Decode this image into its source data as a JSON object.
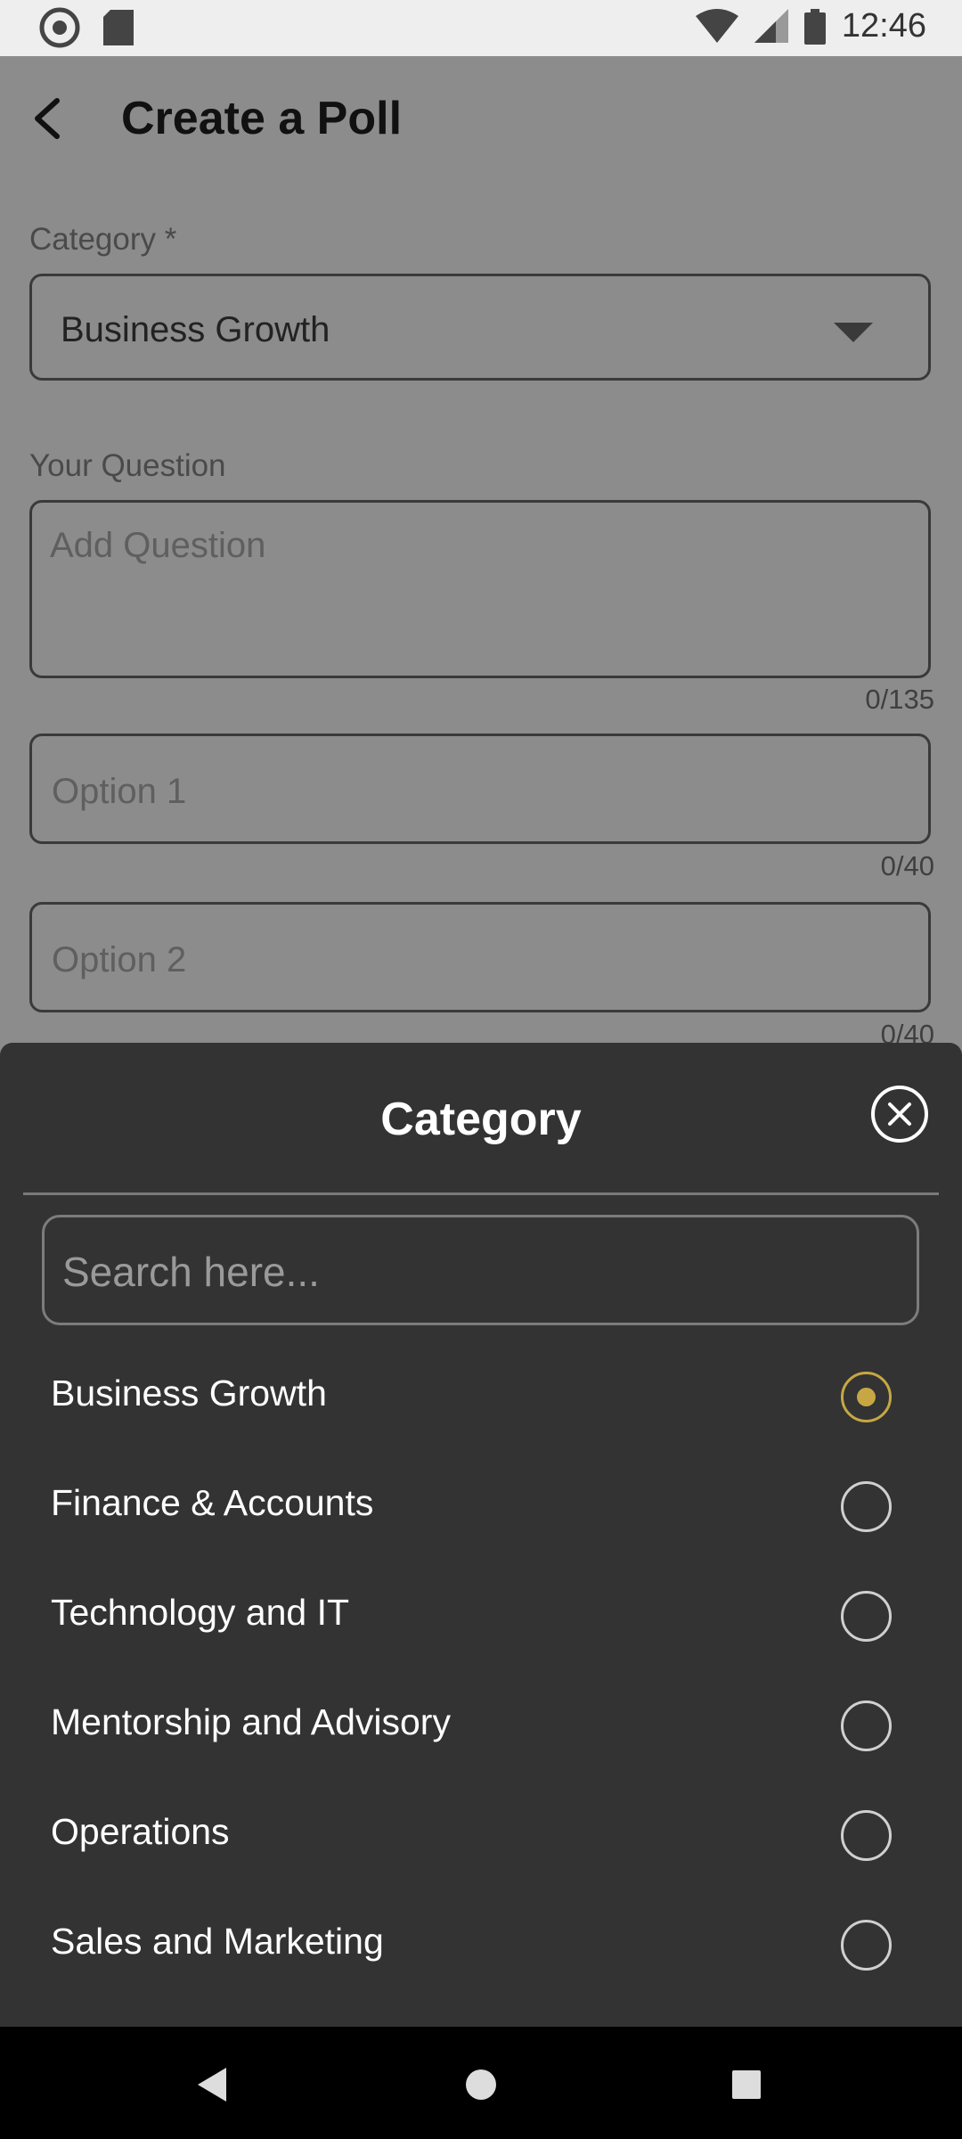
{
  "status_bar": {
    "time": "12:46",
    "icons": [
      "sync-icon",
      "sd-card-icon",
      "wifi-icon",
      "signal-icon",
      "battery-icon"
    ]
  },
  "page": {
    "title": "Create a Poll",
    "category_label": "Category *",
    "category_value": "Business Growth",
    "question_label": "Your Question",
    "question_placeholder": "Add Question",
    "question_counter": "0/135",
    "option1_placeholder": "Option 1",
    "option1_counter": "0/40",
    "option2_placeholder": "Option 2",
    "option2_counter": "0/40"
  },
  "sheet": {
    "title": "Category",
    "search_placeholder": "Search here...",
    "items": [
      {
        "label": "Business Growth",
        "selected": true
      },
      {
        "label": "Finance & Accounts",
        "selected": false
      },
      {
        "label": "Technology and IT",
        "selected": false
      },
      {
        "label": "Mentorship and Advisory",
        "selected": false
      },
      {
        "label": "Operations",
        "selected": false
      },
      {
        "label": "Sales and Marketing",
        "selected": false
      }
    ]
  },
  "colors": {
    "accent": "#c7a744",
    "sheet_bg": "#333333",
    "scrim": "#8c8c8c"
  }
}
